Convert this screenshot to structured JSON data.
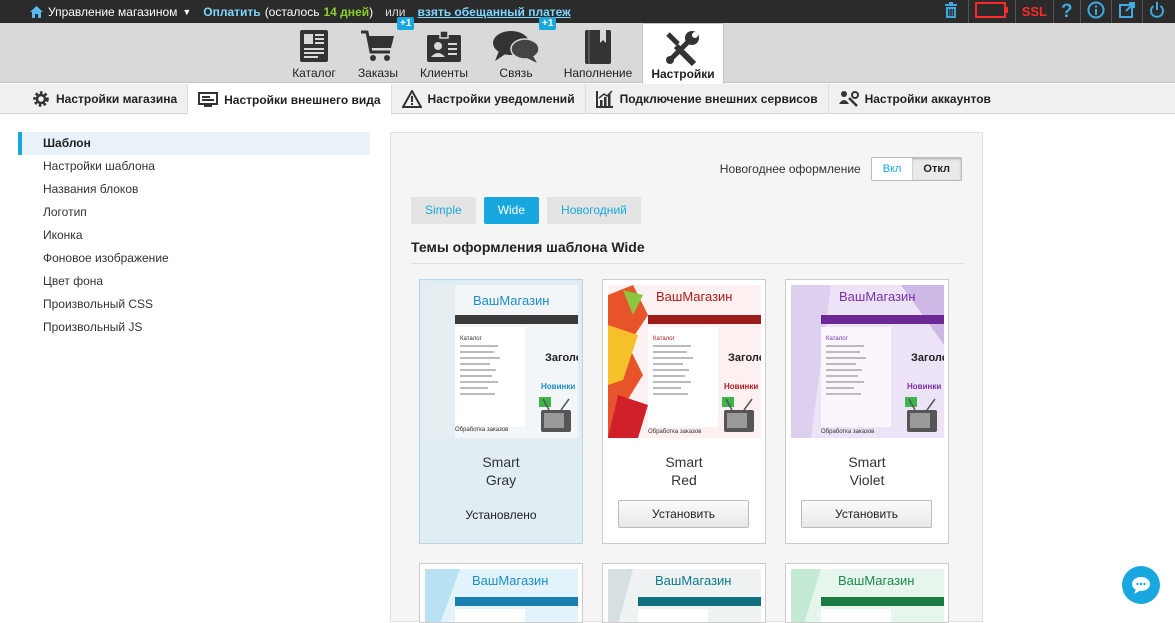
{
  "topbar": {
    "store_menu": "Управление магазином",
    "pay_link": "Оплатить",
    "remaining_prefix": "(осталось",
    "remaining_days": "14 дней",
    "remaining_suffix": ")",
    "or": "или",
    "promise_link": "взять обещанный платеж",
    "ssl": "SSL"
  },
  "mainnav": [
    {
      "label": "Каталог",
      "icon": "catalog-icon"
    },
    {
      "label": "Заказы",
      "icon": "cart-icon",
      "badge": "+1"
    },
    {
      "label": "Клиенты",
      "icon": "clients-icon"
    },
    {
      "label": "Связь",
      "icon": "chat-bubbles-icon",
      "badge": "+1"
    },
    {
      "label": "Наполнение",
      "icon": "book-icon"
    },
    {
      "label": "Настройки",
      "icon": "tools-icon",
      "active": true
    }
  ],
  "subnav": [
    {
      "label": "Настройки магазина",
      "icon": "gear-icon"
    },
    {
      "label": "Настройки внешнего вида",
      "icon": "monitor-icon",
      "active": true
    },
    {
      "label": "Настройки уведомлений",
      "icon": "warning-icon"
    },
    {
      "label": "Подключение внешних сервисов",
      "icon": "chart-icon"
    },
    {
      "label": "Настройки аккаунтов",
      "icon": "account-tools-icon"
    }
  ],
  "sidebar": [
    {
      "label": "Шаблон",
      "active": true
    },
    {
      "label": "Настройки шаблона"
    },
    {
      "label": "Названия блоков"
    },
    {
      "label": "Логотип"
    },
    {
      "label": "Иконка"
    },
    {
      "label": "Фоновое изображение"
    },
    {
      "label": "Цвет фона"
    },
    {
      "label": "Произвольный CSS"
    },
    {
      "label": "Произвольный JS"
    }
  ],
  "panel": {
    "newyear_label": "Новогоднее оформление",
    "toggle_on": "Вкл",
    "toggle_off": "Откл",
    "tabs": [
      {
        "label": "Simple"
      },
      {
        "label": "Wide",
        "active": true
      },
      {
        "label": "Новогодний"
      }
    ],
    "title": "Темы оформления шаблона Wide",
    "thumb_text": {
      "shop": "ВашМагазин",
      "catalog": "Каталог",
      "heading": "Заголо",
      "news": "Новинки",
      "orders": "Обработка заказов"
    },
    "themes": [
      {
        "line1": "Smart",
        "line2": "Gray",
        "status": "Установлено",
        "selected": true,
        "accent": "#1a8fc9",
        "bar": "#3a3a3a"
      },
      {
        "line1": "Smart",
        "line2": "Red",
        "button": "Установить",
        "accent": "#b01c1c",
        "bar": "#9e1b1b"
      },
      {
        "line1": "Smart",
        "line2": "Violet",
        "button": "Установить",
        "accent": "#7a2fa8",
        "bar": "#6b2996"
      }
    ],
    "themes_row2": [
      {
        "accent": "#1a8fc9",
        "bar": "#1a7fb0"
      },
      {
        "accent": "#0f7a8a",
        "bar": "#0f6f7e"
      },
      {
        "accent": "#1b8a4a",
        "bar": "#1b7a42"
      }
    ]
  }
}
